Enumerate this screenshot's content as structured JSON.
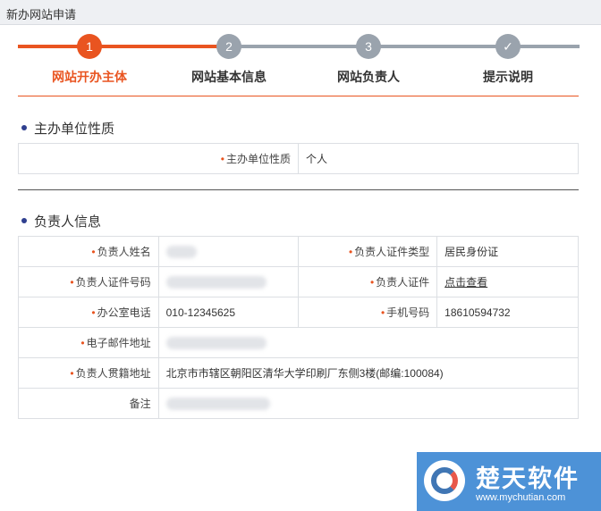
{
  "window": {
    "title": "新办网站申请"
  },
  "steps": [
    {
      "num": "1",
      "label": "网站开办主体",
      "state": "active"
    },
    {
      "num": "2",
      "label": "网站基本信息",
      "state": "todo"
    },
    {
      "num": "3",
      "label": "网站负责人",
      "state": "todo"
    },
    {
      "num": "✓",
      "label": "提示说明",
      "state": "todo"
    }
  ],
  "colors": {
    "accent": "#e95420",
    "inactive": "#9aa3ad",
    "section_dot": "#2f3f8f"
  },
  "section1": {
    "title": "主办单位性质",
    "fields": {
      "nature_label": "主办单位性质",
      "nature_value": "个人"
    }
  },
  "section2": {
    "title": "负责人信息",
    "fields": {
      "name_label": "负责人姓名",
      "id_type_label": "负责人证件类型",
      "id_type_value": "居民身份证",
      "id_number_label": "负责人证件号码",
      "id_doc_label": "负责人证件",
      "id_doc_link": "点击查看",
      "office_phone_label": "办公室电话",
      "office_phone_value": "010-12345625",
      "mobile_label": "手机号码",
      "mobile_value": "18610594732",
      "email_label": "电子邮件地址",
      "address_label": "负责人贯籍地址",
      "address_value": "北京市市辖区朝阳区清华大学印刷厂东侧3楼(邮编:100084)",
      "remark_label": "备注"
    }
  },
  "watermark": {
    "title": "楚天软件",
    "url": "www.mychutian.com"
  }
}
